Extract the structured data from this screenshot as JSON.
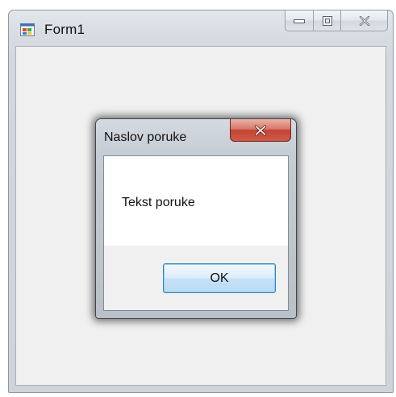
{
  "form": {
    "title": "Form1",
    "icon": "windows-form-icon",
    "caption_buttons": [
      "minimize-icon",
      "maximize-icon",
      "close-icon"
    ]
  },
  "message_box": {
    "title": "Naslov poruke",
    "text": "Tekst poruke",
    "ok_label": "OK",
    "close_icon": "close-icon",
    "close_color": "#c94a3a",
    "ok_border_color": "#3c7fb1"
  }
}
